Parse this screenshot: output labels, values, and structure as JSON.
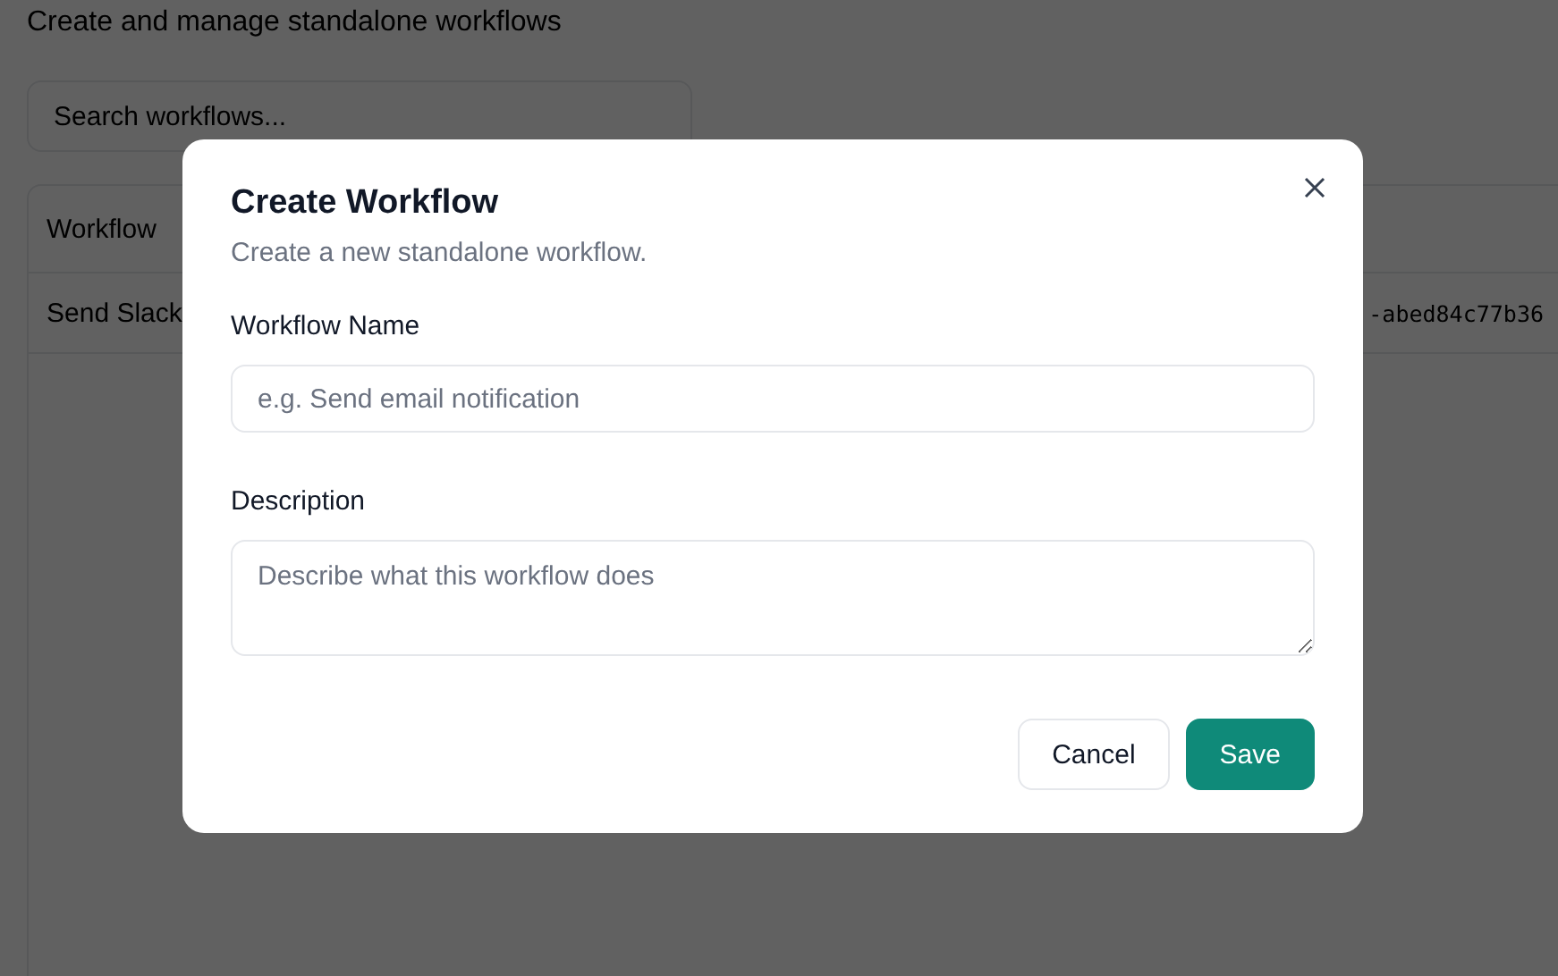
{
  "page": {
    "subtitle": "Create and manage standalone workflows",
    "search": {
      "placeholder": "Search workflows..."
    },
    "table": {
      "columns": [
        "Workflow"
      ],
      "rows": [
        {
          "column_1": "Send Slack",
          "column_2": "-abed84c77b36"
        }
      ]
    }
  },
  "dialog": {
    "title": "Create Workflow",
    "description": "Create a new standalone workflow.",
    "fields": [
      {
        "kind": "input",
        "label": "Workflow Name",
        "placeholder": "e.g. Send email notification"
      },
      {
        "kind": "textarea",
        "label": "Description",
        "placeholder": "Describe what this workflow does"
      }
    ],
    "buttons": [
      {
        "kind": "secondary",
        "label": "Cancel"
      },
      {
        "kind": "primary",
        "label": "Save"
      }
    ]
  }
}
